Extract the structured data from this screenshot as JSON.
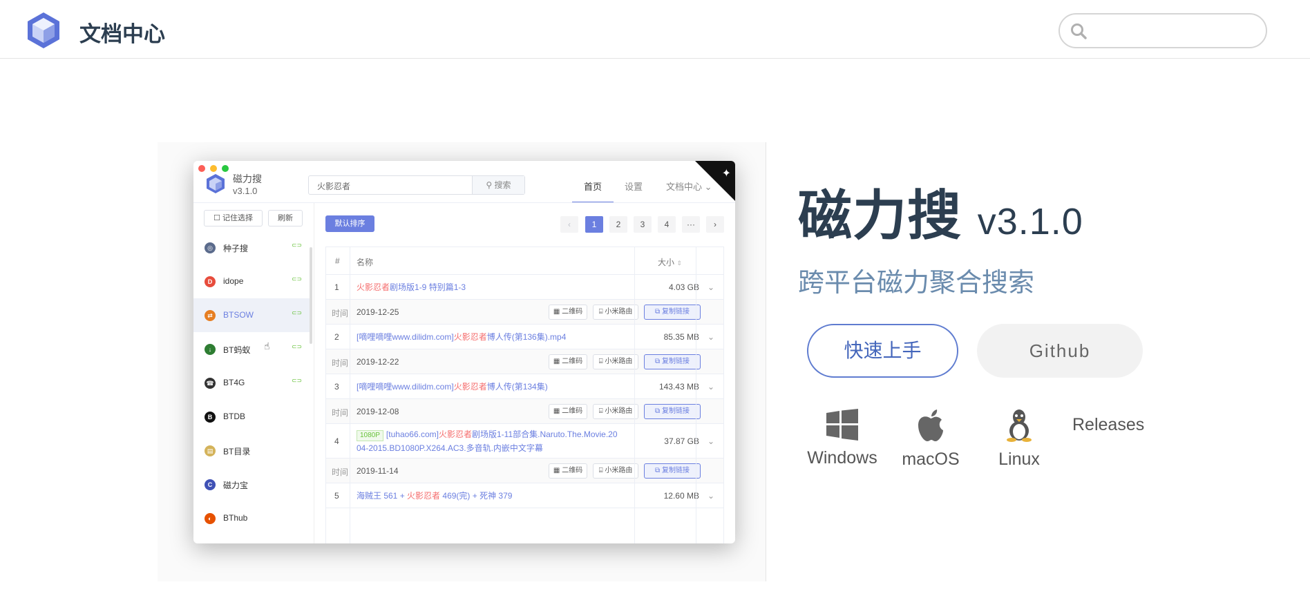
{
  "navbar": {
    "site_title": "文档中心",
    "search_placeholder": ""
  },
  "app": {
    "name": "磁力搜",
    "version": "v3.1.0",
    "search_value": "火影忍者",
    "search_button": "搜索",
    "nav": [
      "首页",
      "设置",
      "文档中心"
    ],
    "remember_label": "记住选择",
    "refresh_label": "刷新",
    "sources": [
      {
        "label": "种子搜",
        "icon": "seed-icon",
        "color": "#5b6b8c",
        "glyph": "◎",
        "link": true
      },
      {
        "label": "idope",
        "icon": "idope-icon",
        "color": "#e74c3c",
        "glyph": "D",
        "link": true
      },
      {
        "label": "BTSOW",
        "icon": "btsow-icon",
        "color": "#e67e22",
        "glyph": "⇄",
        "link": true,
        "active": true
      },
      {
        "label": "BT蚂蚁",
        "icon": "btant-icon",
        "color": "#2e7d32",
        "glyph": "↓",
        "link": true
      },
      {
        "label": "BT4G",
        "icon": "bt4g-icon",
        "color": "#333333",
        "glyph": "☎",
        "link": true
      },
      {
        "label": "BTDB",
        "icon": "btdb-icon",
        "color": "#111111",
        "glyph": "B",
        "link": false
      },
      {
        "label": "BT目录",
        "icon": "btdir-icon",
        "color": "#d4b35a",
        "glyph": "▤",
        "link": false
      },
      {
        "label": "磁力宝",
        "icon": "cilibao-icon",
        "color": "#3f51b5",
        "glyph": "C",
        "link": false
      },
      {
        "label": "BThub",
        "icon": "bthub-icon",
        "color": "#e65100",
        "glyph": "◐",
        "link": false
      }
    ],
    "sort_label": "默认排序",
    "pages": [
      "1",
      "2",
      "3",
      "4",
      "···"
    ],
    "table": {
      "headers": {
        "index": "#",
        "name": "名称",
        "size": "大小"
      },
      "time_label": "时间",
      "actions": [
        "二维码",
        "小米路由",
        "复制链接"
      ],
      "rows": [
        {
          "index": "1",
          "name_kw": "火影忍者",
          "name_rest": "剧场版1-9 特别篇1-3",
          "size": "4.03 GB",
          "time": "2019-12-25"
        },
        {
          "index": "2",
          "name_pre": "[嘀哩嘀哩www.dilidm.com]",
          "name_kw": "火影忍者",
          "name_rest": "博人传(第136集).mp4",
          "size": "85.35 MB",
          "time": "2019-12-22"
        },
        {
          "index": "3",
          "name_pre": "[嘀哩嘀哩www.dilidm.com]",
          "name_kw": "火影忍者",
          "name_rest": "博人传(第134集)",
          "size": "143.43 MB",
          "time": "2019-12-08"
        },
        {
          "index": "4",
          "tag": "1080P",
          "name_pre": "[tuhao66.com]",
          "name_kw": "火影忍者",
          "name_rest": "剧场版1-11部合集.Naruto.The.Movie.20",
          "name_line2": "04-2015.BD1080P.X264.AC3.多音轨.内嵌中文字幕",
          "size": "37.87 GB",
          "time": "2019-11-14"
        },
        {
          "index": "5",
          "name_pre": "海贼王 561 + ",
          "name_kw": "火影忍者",
          "name_rest": " 469(完) + 死神 379",
          "size": "12.60 MB"
        }
      ]
    }
  },
  "hero": {
    "title": "磁力搜",
    "version": "v3.1.0",
    "subtitle": "跨平台磁力聚合搜索",
    "start_button": "快速上手",
    "github_button": "Github",
    "downloads": [
      {
        "label": "Windows",
        "icon": "windows-icon"
      },
      {
        "label": "macOS",
        "icon": "apple-icon"
      },
      {
        "label": "Linux",
        "icon": "linux-icon"
      }
    ],
    "releases": "Releases"
  },
  "colors": {
    "accent": "#6b7fe0",
    "heading": "#2c3e50",
    "subtitle": "#6a8bad",
    "keyword": "#f56c6c",
    "link_green": "#67c23a"
  }
}
